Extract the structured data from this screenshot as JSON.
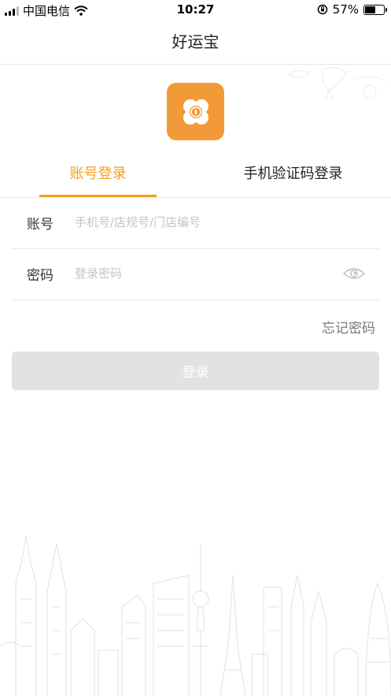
{
  "status_bar": {
    "carrier": "中国电信",
    "time": "10:27",
    "battery_percent": "57%",
    "battery_level": 0.57
  },
  "nav": {
    "title": "好运宝"
  },
  "logo": {
    "icon": "clover-icon",
    "color": "#f29a38"
  },
  "tabs": [
    {
      "label": "账号登录",
      "active": true
    },
    {
      "label": "手机验证码登录",
      "active": false
    }
  ],
  "form": {
    "account_label": "账号",
    "account_placeholder": "手机号/店规号/门店编号",
    "password_label": "密码",
    "password_placeholder": "登录密码",
    "forgot_label": "忘记密码",
    "login_label": "登录"
  },
  "colors": {
    "accent": "#f0a020",
    "button_disabled": "#e2e2e2"
  }
}
